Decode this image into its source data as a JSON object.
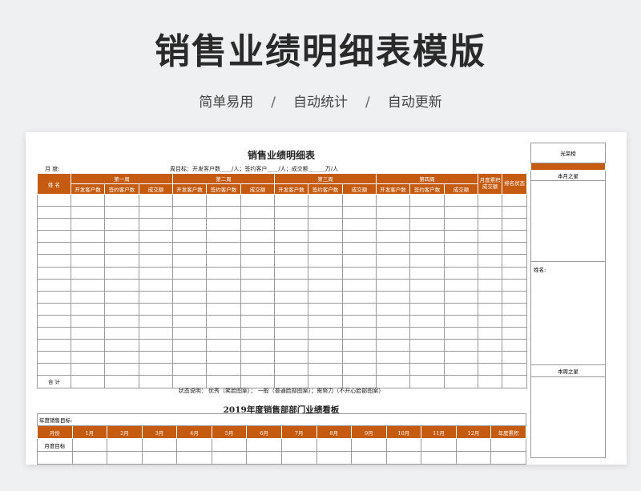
{
  "hero": {
    "title": "销售业绩明细表模版",
    "tags": [
      "简单易用",
      "自动统计",
      "自动更新"
    ],
    "separator": "/"
  },
  "sheet": {
    "title": "销售业绩明细表",
    "month_label": "月  度:",
    "target_line": "周目标：开发客户数____/人；签约客户____/人；成交额______万/人",
    "headers": {
      "name": "姓  名",
      "weeks": [
        "第一周",
        "第二周",
        "第三周",
        "第四周"
      ],
      "sub": [
        "开发客户数",
        "签约客户数",
        "成交额"
      ],
      "month_total": "月度累积成交额",
      "rank_status": "排名状态"
    },
    "total_label": "合  计",
    "legend": "状态说明：  优秀（笑脸图案）；   一般（普通脸部图案）；需努力（不开心脸部图案）"
  },
  "board": {
    "title": "2019年度销售部部门业绩看板",
    "annual_target_label": "年度销售目标:",
    "month_col": "月份",
    "months": [
      "1月",
      "2月",
      "3月",
      "4月",
      "5月",
      "6月",
      "7月",
      "8月",
      "9月",
      "10月",
      "11月",
      "12月"
    ],
    "annual_total": "年度累积",
    "row_label": "月度目标"
  },
  "side": {
    "glory": "光荣榜",
    "star_month": "本月之星",
    "name_label": "姓名:",
    "star_week": "本周之星"
  },
  "colors": {
    "accent": "#c55a11",
    "background": "#eff0f2"
  }
}
